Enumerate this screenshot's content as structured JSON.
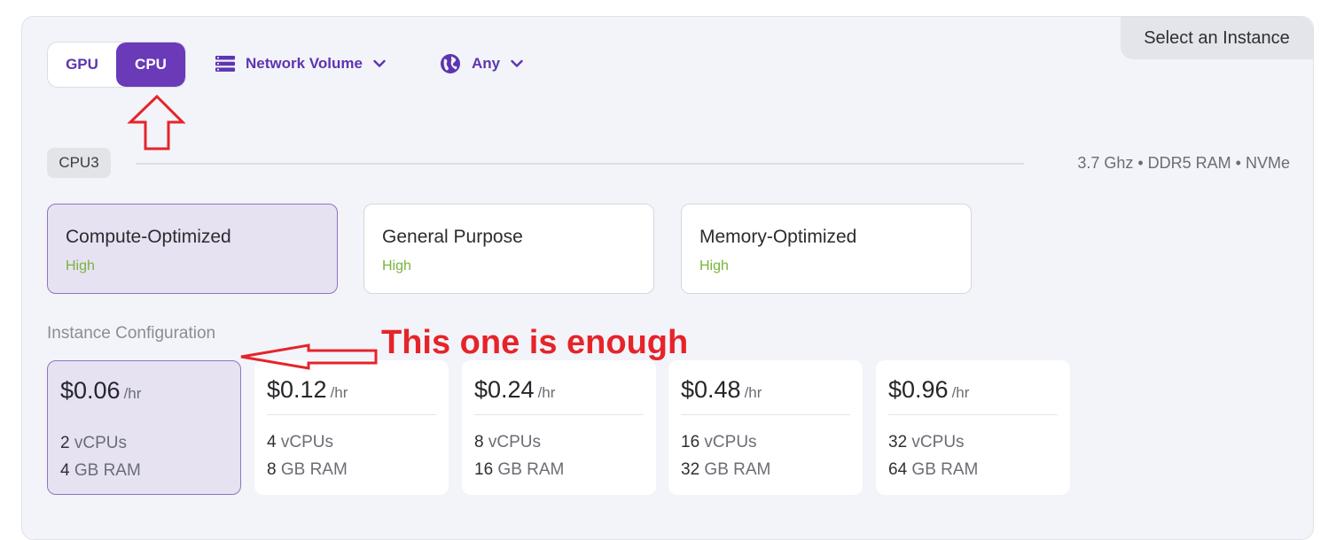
{
  "header": {
    "select_instance": "Select an Instance",
    "toggle": {
      "gpu": "GPU",
      "cpu": "CPU",
      "active": "CPU"
    },
    "network_volume": "Network Volume",
    "region": "Any"
  },
  "cpu_group": {
    "badge": "CPU3",
    "specs": "3.7 Ghz • DDR5 RAM • NVMe"
  },
  "categories": [
    {
      "name": "Compute-Optimized",
      "level": "High",
      "selected": true
    },
    {
      "name": "General Purpose",
      "level": "High",
      "selected": false
    },
    {
      "name": "Memory-Optimized",
      "level": "High",
      "selected": false
    }
  ],
  "instance_config": {
    "label": "Instance Configuration",
    "unit": "/hr",
    "vcpu_suffix": "vCPUs",
    "ram_suffix": "GB RAM",
    "options": [
      {
        "price": "$0.06",
        "vcpus": "2",
        "ram": "4",
        "selected": true
      },
      {
        "price": "$0.12",
        "vcpus": "4",
        "ram": "8",
        "selected": false
      },
      {
        "price": "$0.24",
        "vcpus": "8",
        "ram": "16",
        "selected": false
      },
      {
        "price": "$0.48",
        "vcpus": "16",
        "ram": "32",
        "selected": false
      },
      {
        "price": "$0.96",
        "vcpus": "32",
        "ram": "64",
        "selected": false
      }
    ]
  },
  "annotation": {
    "text": "This one is enough",
    "color": "#e5242a"
  },
  "colors": {
    "accent": "#6a3ab8",
    "accent_text": "#5e35b1",
    "level_green": "#78b43c"
  },
  "icons": {
    "network_volume": "server-stack-icon",
    "region": "globe-icon",
    "dropdown": "chevron-down-icon"
  }
}
